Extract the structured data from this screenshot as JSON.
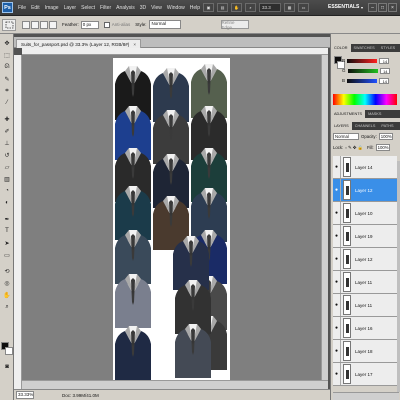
{
  "app": {
    "logo": "Ps",
    "workspace": "ESSENTIALS",
    "workspace_arrow": "▾"
  },
  "menu": [
    "File",
    "Edit",
    "Image",
    "Layer",
    "Select",
    "Filter",
    "Analysis",
    "3D",
    "View",
    "Window",
    "Help"
  ],
  "menubar_controls": {
    "zoom": "33.3"
  },
  "window_buttons": {
    "minimize": "–",
    "restore": "□",
    "close": "×"
  },
  "options": {
    "feather_label": "Feather:",
    "feather_value": "0 px",
    "antialias_label": "Anti-alias",
    "style_label": "Style:",
    "style_value": "Normal",
    "refine_edge": "Refine Edge..."
  },
  "document": {
    "tab_label": "Suits_for_passport.psd @ 33.3% (Layer 12, RGB/8#)",
    "close": "×"
  },
  "status": {
    "zoom": "33.33%",
    "doc_info": "Doc: 3.99M/41.0M"
  },
  "color_panel": {
    "tabs": [
      "COLOR",
      "SWATCHES",
      "STYLES"
    ],
    "rows": [
      {
        "label": "R",
        "value": "14"
      },
      {
        "label": "G",
        "value": "14"
      },
      {
        "label": "B",
        "value": "14"
      }
    ],
    "colors": {
      "foreground": "#0e0e0e",
      "background": "#ffffff",
      "red": "#e23b3b",
      "green": "#3bb54a",
      "blue": "#3b5ee2"
    }
  },
  "adjustments_tabs": [
    "ADJUSTMENTS",
    "MASKS"
  ],
  "layers_panel": {
    "tabs": [
      "LAYERS",
      "CHANNELS",
      "PATHS"
    ],
    "blend_mode": "Normal",
    "opacity_label": "Opacity:",
    "opacity_value": "100%",
    "lock_label": "Lock:",
    "fill_label": "Fill:",
    "fill_value": "100%",
    "eye": "●",
    "layers": [
      "Layer 14",
      "Layer 12",
      "Layer 10",
      "Layer 19",
      "Layer 12",
      "Layer 11",
      "Layer 11",
      "Layer 16",
      "Layer 18",
      "Layer 17"
    ],
    "selected_index": 1
  },
  "canvas": {
    "selection_accent": "#3a8fe8"
  }
}
